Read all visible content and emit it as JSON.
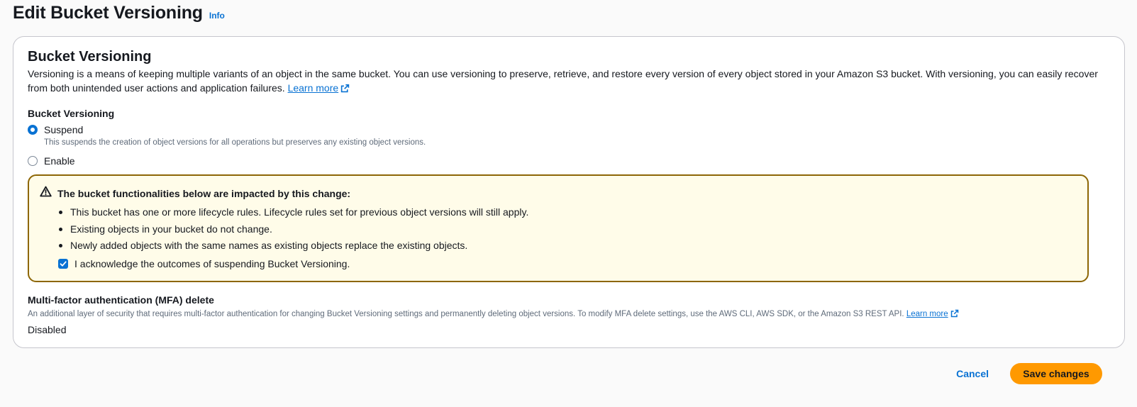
{
  "header": {
    "title": "Edit Bucket Versioning",
    "info_link": "Info"
  },
  "versioning": {
    "title": "Bucket Versioning",
    "description": "Versioning is a means of keeping multiple variants of an object in the same bucket. You can use versioning to preserve, retrieve, and restore every version of every object stored in your Amazon S3 bucket. With versioning, you can easily recover from both unintended user actions and application failures.",
    "learn_more": "Learn more",
    "field_label": "Bucket Versioning",
    "options": [
      {
        "label": "Suspend",
        "description": "This suspends the creation of object versions for all operations but preserves any existing object versions.",
        "selected": true
      },
      {
        "label": "Enable",
        "selected": false
      }
    ]
  },
  "alert": {
    "title": "The bucket functionalities below are impacted by this change:",
    "items": [
      "This bucket has one or more lifecycle rules. Lifecycle rules set for previous object versions will still apply.",
      "Existing objects in your bucket do not change.",
      "Newly added objects with the same names as existing objects replace the existing objects."
    ],
    "acknowledge_label": "I acknowledge the outcomes of suspending Bucket Versioning.",
    "acknowledged": true,
    "border_color": "#8d6605",
    "background_color": "#fffce9"
  },
  "mfa": {
    "title": "Multi-factor authentication (MFA) delete",
    "description": "An additional layer of security that requires multi-factor authentication for changing Bucket Versioning settings and permanently deleting object versions. To modify MFA delete settings, use the AWS CLI, AWS SDK, or the Amazon S3 REST API.",
    "learn_more": "Learn more",
    "value": "Disabled"
  },
  "actions": {
    "cancel_label": "Cancel",
    "save_label": "Save changes",
    "primary_color": "#ff9900",
    "link_color": "#0972d3"
  },
  "icons": {
    "external_link": "external-link-icon",
    "warning": "warning-icon",
    "check": "check-icon"
  }
}
